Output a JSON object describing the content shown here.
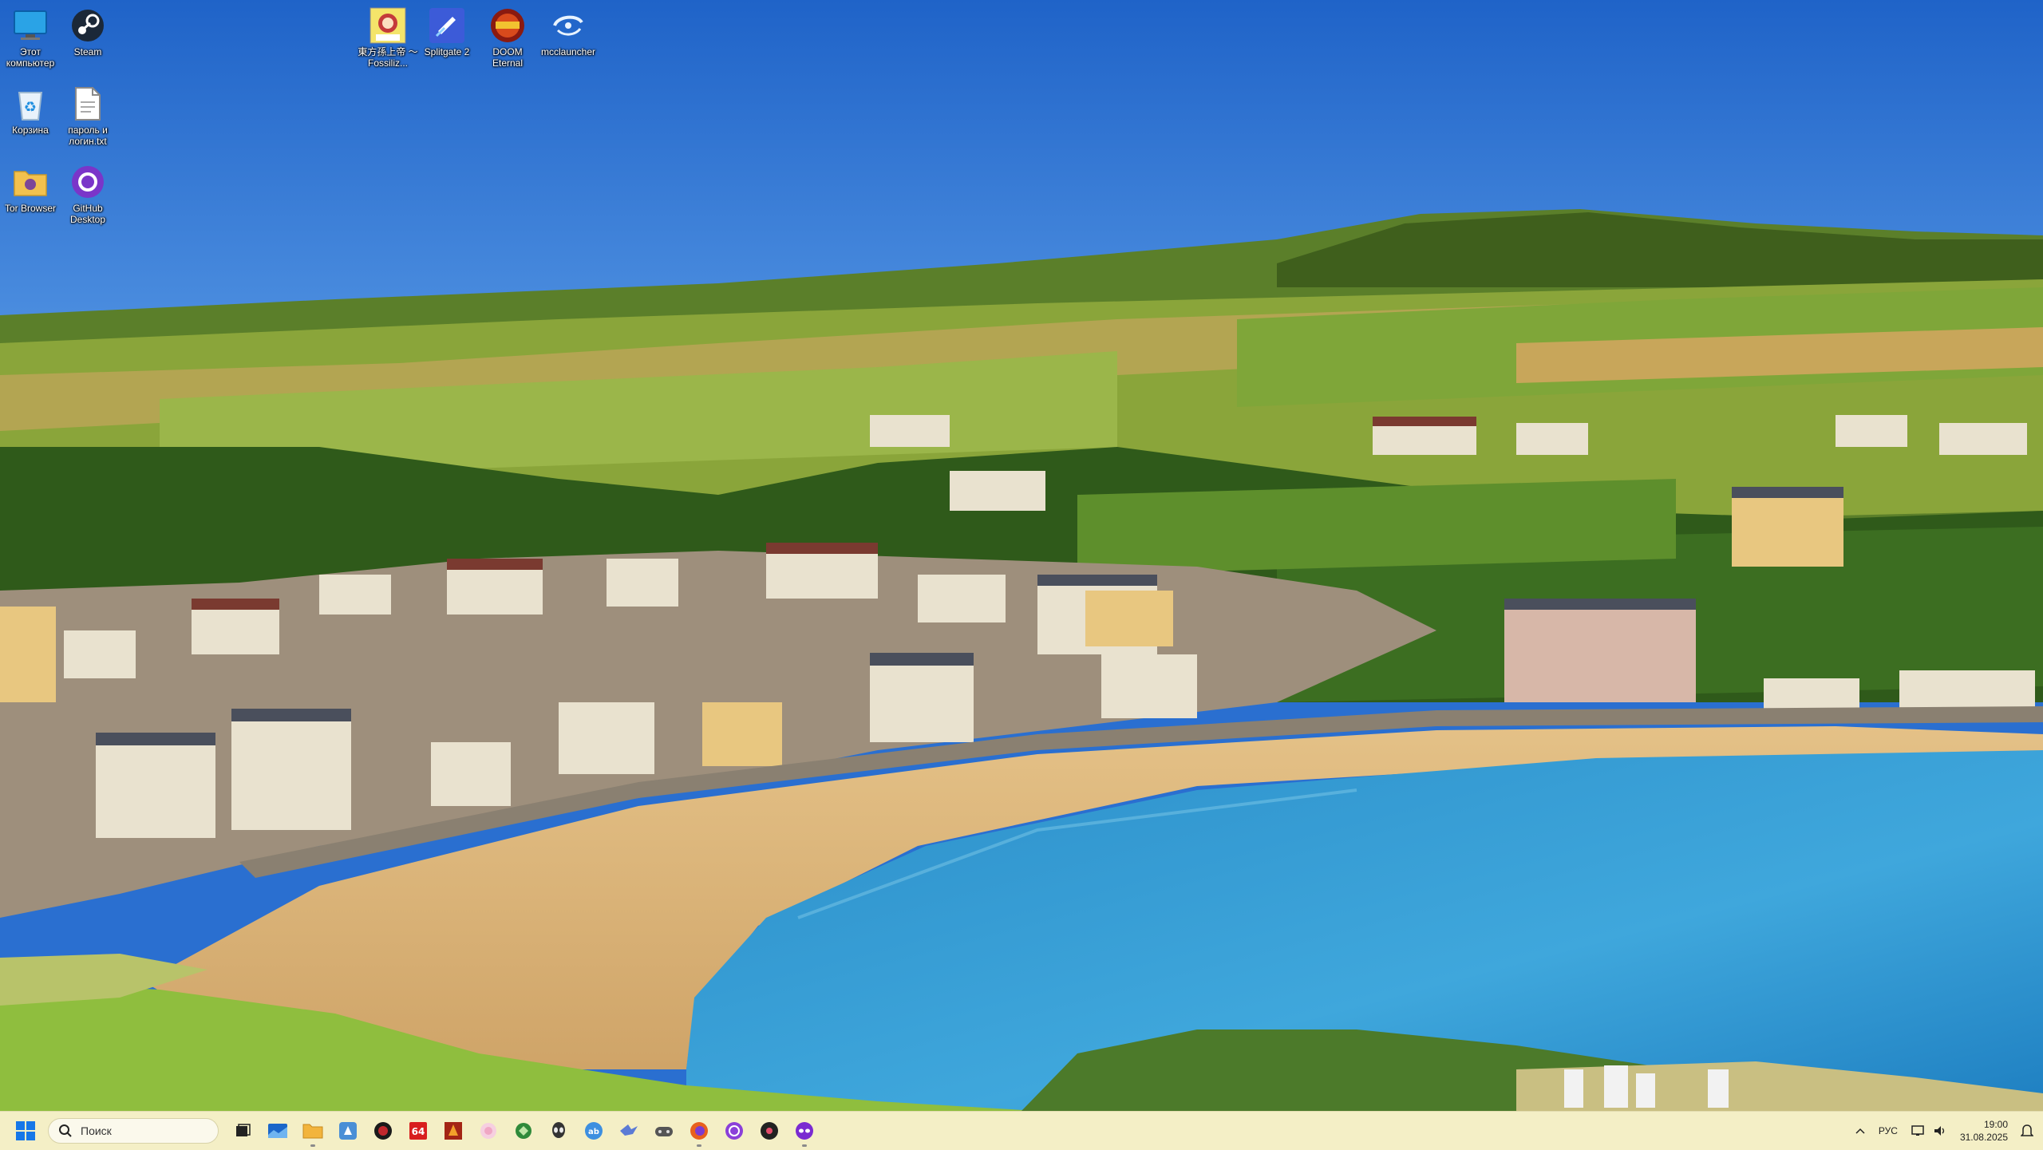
{
  "desktop": {
    "icons": [
      {
        "label": "Этот компьютер",
        "icon": "monitor-icon"
      },
      {
        "label": "Steam",
        "icon": "steam-icon"
      },
      {
        "label": "Корзина",
        "icon": "recycle-bin-icon"
      },
      {
        "label": "пароль и логин.txt",
        "icon": "text-file-icon"
      },
      {
        "label": "Tor Browser",
        "icon": "tor-folder-icon"
      },
      {
        "label": "GitHub Desktop",
        "icon": "github-icon"
      },
      {
        "label": "東方孫上帝 ～ Fossiliz...",
        "icon": "touhou-game-icon"
      },
      {
        "label": "Splitgate 2",
        "icon": "splitgate-icon"
      },
      {
        "label": "DOOM Eternal",
        "icon": "doom-icon"
      },
      {
        "label": "mcclauncher",
        "icon": "launcher-icon"
      }
    ]
  },
  "taskbar": {
    "search_placeholder": "Поиск",
    "pinned": [
      {
        "name": "task-view",
        "icon": "task-view-icon",
        "color": "#222222"
      },
      {
        "name": "widgets",
        "icon": "widgets-icon",
        "color": "#1b66c9"
      },
      {
        "name": "file-explorer",
        "icon": "folder-icon",
        "color": "#f2b43c"
      },
      {
        "name": "app-4",
        "icon": "app-blue-icon",
        "color": "#4a8fd6"
      },
      {
        "name": "app-5",
        "icon": "red-circle-icon",
        "color": "#c1272d"
      },
      {
        "name": "app-6",
        "icon": "red-64-icon",
        "color": "#d81e1e"
      },
      {
        "name": "app-7",
        "icon": "doom-small-icon",
        "color": "#a32515"
      },
      {
        "name": "app-8",
        "icon": "pink-app-icon",
        "color": "#f0a7c4"
      },
      {
        "name": "app-9",
        "icon": "green-app-icon",
        "color": "#2f8a3a"
      },
      {
        "name": "app-10",
        "icon": "alien-icon",
        "color": "#333333"
      },
      {
        "name": "app-11",
        "icon": "blue-chat-icon",
        "color": "#3d8fe0"
      },
      {
        "name": "app-12",
        "icon": "bird-icon",
        "color": "#5b7bd5"
      },
      {
        "name": "app-13",
        "icon": "gamepad-icon",
        "color": "#555555"
      },
      {
        "name": "app-14",
        "icon": "firefox-icon",
        "color": "#e8601c"
      },
      {
        "name": "app-15",
        "icon": "purple-circle-icon",
        "color": "#8b3fd9"
      },
      {
        "name": "app-16",
        "icon": "dark-app-icon",
        "color": "#222222"
      },
      {
        "name": "app-17",
        "icon": "purple-mask-icon",
        "color": "#7a2ad1"
      }
    ],
    "tray": {
      "language": "РУС",
      "time": "19:00",
      "date": "31.08.2025"
    }
  }
}
